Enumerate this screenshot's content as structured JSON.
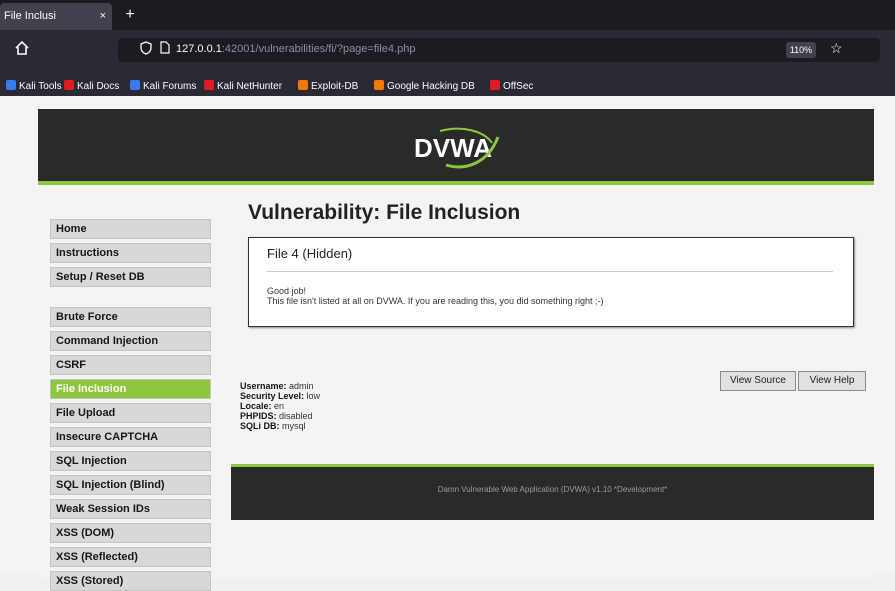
{
  "browser": {
    "tab_title": "File Inclusi",
    "tab_close": "×",
    "new_tab": "+",
    "url_host": "127.0.0.1",
    "url_rest": ":42001/vulnerabilities/fi/?page=file4.php",
    "zoom": "110%",
    "bookmarks": [
      {
        "label": "Kali Tools",
        "color": "#367bf0"
      },
      {
        "label": "Kali Docs",
        "color": "#e01b24"
      },
      {
        "label": "Kali Forums",
        "color": "#367bf0"
      },
      {
        "label": "Kali NetHunter",
        "color": "#e01b24"
      },
      {
        "label": "Exploit-DB",
        "color": "#f57900"
      },
      {
        "label": "Google Hacking DB",
        "color": "#f57900"
      },
      {
        "label": "OffSec",
        "color": "#e01b24"
      }
    ]
  },
  "logo": {
    "text": "DVWA",
    "accent": "#8dc63f"
  },
  "menu": {
    "group1": [
      "Home",
      "Instructions",
      "Setup / Reset DB"
    ],
    "group2": [
      "Brute Force",
      "Command Injection",
      "CSRF",
      "File Inclusion",
      "File Upload",
      "Insecure CAPTCHA",
      "SQL Injection",
      "SQL Injection (Blind)",
      "Weak Session IDs",
      "XSS (DOM)",
      "XSS (Reflected)",
      "XSS (Stored)"
    ],
    "selected": "File Inclusion"
  },
  "main": {
    "title": "Vulnerability: File Inclusion",
    "box_title": "File 4 (Hidden)",
    "box_line1": "Good job!",
    "box_line2": "This file isn't listed at all on DVWA. If you are reading this, you did something right ;-)"
  },
  "info": {
    "username_label": "Username:",
    "username": "admin",
    "security_label": "Security Level:",
    "security": "low",
    "locale_label": "Locale:",
    "locale": "en",
    "phpids_label": "PHPIDS:",
    "phpids": "disabled",
    "sqlidb_label": "SQLi DB:",
    "sqlidb": "mysql"
  },
  "buttons": {
    "view_source": "View Source",
    "view_help": "View Help"
  },
  "footer": {
    "text": "Damn Vulnerable Web Application (DVWA) v1.10 *Development*"
  }
}
